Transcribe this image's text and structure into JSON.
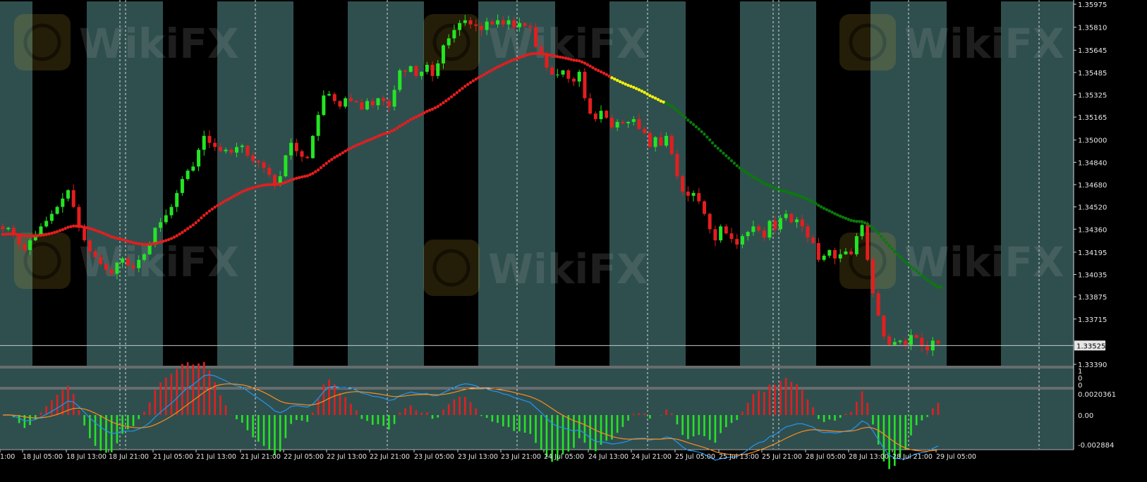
{
  "chart_data": {
    "type": "candlestick",
    "symbol_watermark": "WikiFX",
    "current_price": "1.33525",
    "price_ticks": [
      "1.35975",
      "1.35810",
      "1.35645",
      "1.35485",
      "1.35325",
      "1.35165",
      "1.35000",
      "1.34840",
      "1.34680",
      "1.34520",
      "1.34360",
      "1.34195",
      "1.34035",
      "1.33875",
      "1.33715",
      "1.33555",
      "1.33390"
    ],
    "price_tick_values": [
      1.35975,
      1.3581,
      1.35645,
      1.35485,
      1.35325,
      1.35165,
      1.35,
      1.3484,
      1.3468,
      1.3452,
      1.3436,
      1.34195,
      1.34035,
      1.33875,
      1.33715,
      1.33555,
      1.3339
    ],
    "time_labels": [
      "1:00",
      "18 Jul 05:00",
      "18 Jul 13:00",
      "18 Jul 21:00",
      "21 Jul 05:00",
      "21 Jul 13:00",
      "21 Jul 21:00",
      "22 Jul 05:00",
      "22 Jul 13:00",
      "22 Jul 21:00",
      "23 Jul 05:00",
      "23 Jul 13:00",
      "23 Jul 21:00",
      "24 Jul 05:00",
      "24 Jul 13:00",
      "24 Jul 21:00",
      "25 Jul 05:00",
      "25 Jul 13:00",
      "25 Jul 21:00",
      "28 Jul 05:00",
      "28 Jul 13:00",
      "28 Jul 21:00",
      "29 Jul 05:00"
    ],
    "empty_panel_ticks": [
      "1",
      "0",
      "0"
    ],
    "macd_ticks": [
      "0.0020361",
      "0.00",
      "-0.002884"
    ],
    "macd_tick_values": [
      0.0020361,
      0,
      -0.002884
    ],
    "closes": [
      1.3436,
      1.3437,
      1.3432,
      1.3425,
      1.3421,
      1.3428,
      1.3432,
      1.3438,
      1.3442,
      1.3447,
      1.3452,
      1.3458,
      1.3464,
      1.3452,
      1.3437,
      1.3428,
      1.342,
      1.3416,
      1.3411,
      1.3407,
      1.3404,
      1.3412,
      1.3415,
      1.341,
      1.3408,
      1.3414,
      1.3418,
      1.3425,
      1.3437,
      1.3441,
      1.3446,
      1.3452,
      1.3462,
      1.3472,
      1.3478,
      1.3481,
      1.3493,
      1.3503,
      1.3498,
      1.3495,
      1.3492,
      1.3493,
      1.3491,
      1.3495,
      1.3496,
      1.3489,
      1.3485,
      1.3484,
      1.348,
      1.3475,
      1.3468,
      1.3474,
      1.3489,
      1.3498,
      1.3492,
      1.3488,
      1.3487,
      1.3503,
      1.3518,
      1.3532,
      1.3533,
      1.3528,
      1.3524,
      1.353,
      1.3528,
      1.3527,
      1.3522,
      1.3528,
      1.3525,
      1.353,
      1.3528,
      1.3524,
      1.3536,
      1.355,
      1.3549,
      1.3553,
      1.3546,
      1.3549,
      1.3554,
      1.3546,
      1.3555,
      1.3568,
      1.3573,
      1.3579,
      1.3584,
      1.3586,
      1.3583,
      1.3582,
      1.3579,
      1.3585,
      1.3583,
      1.3586,
      1.3583,
      1.3586,
      1.3581,
      1.3584,
      1.3582,
      1.3581,
      1.3567,
      1.3562,
      1.3552,
      1.3547,
      1.3547,
      1.355,
      1.3544,
      1.3542,
      1.3549,
      1.353,
      1.3519,
      1.3515,
      1.3521,
      1.3516,
      1.3509,
      1.3513,
      1.3512,
      1.3513,
      1.3515,
      1.3508,
      1.3505,
      1.3495,
      1.3502,
      1.3496,
      1.3503,
      1.349,
      1.3474,
      1.3463,
      1.346,
      1.3462,
      1.3456,
      1.3447,
      1.3436,
      1.3428,
      1.3438,
      1.3433,
      1.3429,
      1.3425,
      1.3431,
      1.3434,
      1.3438,
      1.3435,
      1.343,
      1.3442,
      1.3436,
      1.3444,
      1.3447,
      1.3441,
      1.3443,
      1.3438,
      1.343,
      1.3426,
      1.3414,
      1.3417,
      1.3421,
      1.3415,
      1.3418,
      1.342,
      1.3418,
      1.3431,
      1.3439,
      1.3414,
      1.339,
      1.3374,
      1.3359,
      1.3353,
      1.3355,
      1.3356,
      1.3353,
      1.336,
      1.3358,
      1.3352,
      1.3349,
      1.3356,
      1.3354
    ],
    "ma_color_segments": [
      {
        "color": "red",
        "from_index": 0,
        "to_index": 112
      },
      {
        "color": "yellow",
        "from_index": 112,
        "to_index": 122
      },
      {
        "color": "green",
        "from_index": 122,
        "to_index": 173
      }
    ],
    "colors": {
      "bull": "#24e424",
      "bear": "#e41e1e",
      "band_light": "#2f4f4f",
      "band_dark": "#000000",
      "ma_red": "#e41e1e",
      "ma_yellow": "#f2f20a",
      "ma_green": "#0a7a0a",
      "macd_main": "#2196f3",
      "macd_signal": "#ff8c1a"
    },
    "legend": "none",
    "grid": false
  }
}
